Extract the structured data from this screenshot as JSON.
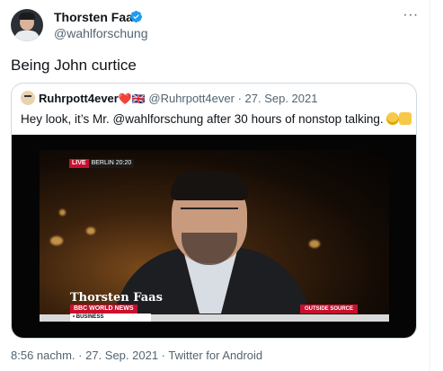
{
  "author": {
    "name": "Thorsten Faas",
    "handle": "@wahlforschung",
    "verified": true
  },
  "tweet": {
    "text": "Being John curtice",
    "timestamp": "8:56 nachm. · 27. Sep. 2021 · Twitter for Android"
  },
  "quoted_tweet": {
    "name": "Ruhrpott4ever",
    "name_emojis": "❤️🇬🇧",
    "meta": "@Ruhrpott4ever · 27. Sep. 2021",
    "text": "Hey look, it’s Mr. @wahlforschung after 30 hours of nonstop talking."
  },
  "video_overlay": {
    "live_label": "LIVE",
    "location_time": "BERLIN  20:20",
    "nameplate": "Thorsten Faas",
    "channel": "BBC WORLD NEWS",
    "section": "• BUSINESS",
    "segment": "OUTSIDE SOURCE"
  },
  "icons": {
    "verified": "verified-badge-icon",
    "more": "more-options-icon"
  },
  "colors": {
    "text_primary": "#0f1419",
    "text_secondary": "#536471",
    "verified_blue": "#1d9bf0",
    "border": "#cfd9de",
    "bbc_red": "#c8102e"
  }
}
